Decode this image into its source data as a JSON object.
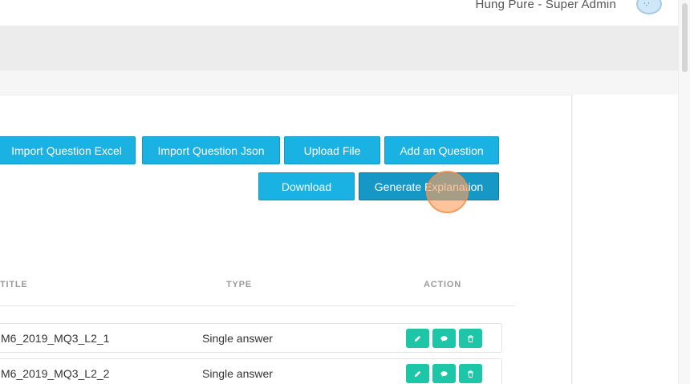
{
  "header": {
    "user_name": "Hung Pure - Super Admin",
    "avatar_face": "·.·"
  },
  "toolbar": {
    "import_excel": "Import Question Excel",
    "import_json": "Import Question Json",
    "upload_file": "Upload File",
    "add_question": "Add an Question",
    "download": "Download",
    "generate_explanation": "Generate Explanation"
  },
  "table": {
    "headers": {
      "title": "TITLE",
      "type": "TYPE",
      "action": "ACTION"
    },
    "rows": [
      {
        "title": "M6_2019_MQ3_L2_1",
        "type": "Single answer"
      },
      {
        "title": "M6_2019_MQ3_L2_2",
        "type": "Single answer"
      }
    ],
    "actions": [
      "edit-icon",
      "comment-icon",
      "trash-icon"
    ]
  },
  "colors": {
    "primary": "#1ab1e3",
    "action": "#1ec6a8"
  }
}
